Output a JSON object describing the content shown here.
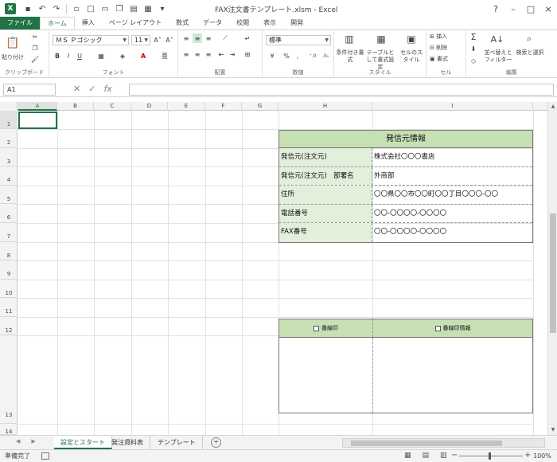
{
  "window": {
    "title": "FAX注文書テンプレート.xlsm - Excel",
    "app_icon": "X",
    "controls": [
      "?",
      "–",
      "□",
      "×"
    ]
  },
  "ribbon": {
    "tabs": [
      "ファイル",
      "ホーム",
      "挿入",
      "ページ レイアウト",
      "数式",
      "データ",
      "校閲",
      "表示",
      "開発"
    ],
    "groups": {
      "clipboard": {
        "label": "クリップボード",
        "paste": "貼り付け"
      },
      "font": {
        "label": "フォント",
        "font_name": "ＭＳ Ｐゴシック",
        "font_size": "11",
        "bold": "B",
        "italic": "I",
        "underline": "U",
        "grow": "A˄",
        "shrink": "A˅"
      },
      "alignment": {
        "label": "配置"
      },
      "number": {
        "label": "数値",
        "format": "標準",
        "percent": "%",
        "comma": ","
      },
      "styles": {
        "label": "スタイル",
        "conditional": "条件付き書式",
        "table": "テーブルとして書式設定",
        "cell_style": "セルのスタイル"
      },
      "cells": {
        "label": "セル",
        "insert": "挿入",
        "delete": "削除",
        "format": "書式"
      },
      "editing": {
        "label": "編集",
        "sort": "並べ替えとフィルター",
        "find": "検索と選択"
      }
    }
  },
  "formula_bar": {
    "namebox": "A1",
    "cancel": "✕",
    "enter": "✓",
    "fx": "fx",
    "formula": ""
  },
  "grid": {
    "columns": [
      "A",
      "B",
      "C",
      "D",
      "E",
      "F",
      "G",
      "H",
      "I"
    ],
    "rows": [
      "1",
      "2",
      "3",
      "4",
      "5",
      "6",
      "7",
      "8",
      "9",
      "10",
      "11",
      "12",
      "13",
      "14"
    ]
  },
  "info_table": {
    "title": "発信元情報",
    "rows": [
      {
        "key": "発信元(注文元)",
        "value": "株式会社〇〇〇書店"
      },
      {
        "key": "発信元(注文元)　部署名",
        "value": "外商部"
      },
      {
        "key": "住所",
        "value": "〇〇県〇〇市〇〇町〇〇丁目〇〇〇-〇〇"
      },
      {
        "key": "電話番号",
        "value": "〇〇-〇〇〇〇-〇〇〇〇"
      },
      {
        "key": "FAX番号",
        "value": "〇〇-〇〇〇〇-〇〇〇〇"
      }
    ]
  },
  "checkbox_table": {
    "left_label": "番線印",
    "right_label": "番線印情報"
  },
  "sheets": {
    "tabs": [
      "設定とスタート",
      "発注資料表",
      "テンプレート"
    ],
    "active": 0,
    "add": "+"
  },
  "status": {
    "ready": "準備完了",
    "zoom": "100%"
  }
}
